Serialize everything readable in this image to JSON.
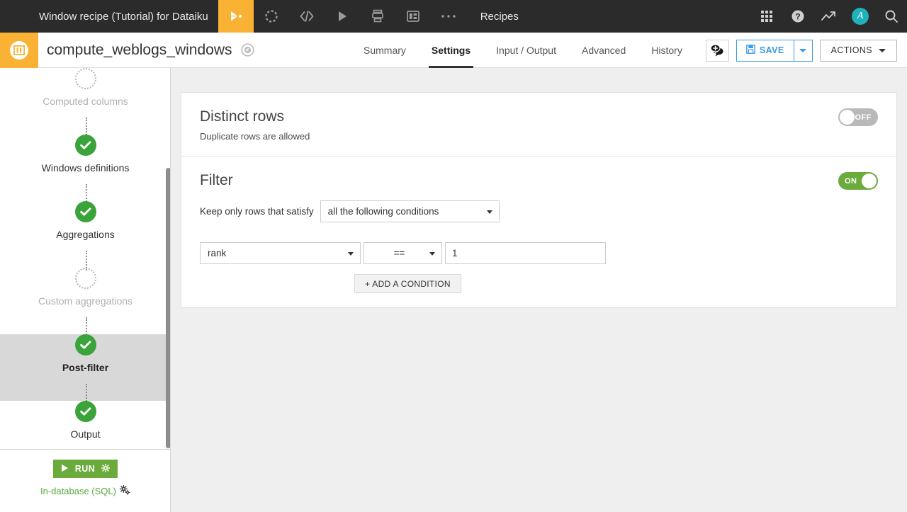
{
  "topbar": {
    "project_title": "Window recipe (Tutorial) for Dataiku",
    "section_label": "Recipes",
    "nav_icons": [
      {
        "name": "flow-icon",
        "active": true
      },
      {
        "name": "datasets-icon",
        "active": false
      },
      {
        "name": "code-icon",
        "active": false
      },
      {
        "name": "jobs-run-icon",
        "active": false
      },
      {
        "name": "jobs-icon",
        "active": false
      },
      {
        "name": "dashboards-icon",
        "active": false
      },
      {
        "name": "more-icon",
        "active": false
      }
    ],
    "right_icons": [
      {
        "name": "apps-grid-icon"
      },
      {
        "name": "help-icon"
      },
      {
        "name": "activity-icon"
      },
      {
        "name": "avatar"
      },
      {
        "name": "search-icon"
      }
    ],
    "avatar_initial": "A"
  },
  "header": {
    "recipe_name": "compute_weblogs_windows",
    "tabs": [
      {
        "label": "Summary",
        "active": false
      },
      {
        "label": "Settings",
        "active": true
      },
      {
        "label": "Input / Output",
        "active": false
      },
      {
        "label": "Advanced",
        "active": false
      },
      {
        "label": "History",
        "active": false
      }
    ],
    "save_label": "SAVE",
    "actions_label": "ACTIONS"
  },
  "sidebar": {
    "steps": [
      {
        "label": "Computed columns",
        "state": "todo",
        "active": false
      },
      {
        "label": "Windows definitions",
        "state": "done",
        "active": false
      },
      {
        "label": "Aggregations",
        "state": "done",
        "active": false
      },
      {
        "label": "Custom aggregations",
        "state": "todo",
        "active": false
      },
      {
        "label": "Post-filter",
        "state": "done",
        "active": true
      },
      {
        "label": "Output",
        "state": "done",
        "active": false
      }
    ],
    "run_label": "RUN",
    "engine_label": "In-database (SQL)"
  },
  "main": {
    "distinct": {
      "title": "Distinct rows",
      "subtitle": "Duplicate rows are allowed",
      "toggle_state": "OFF"
    },
    "filter": {
      "title": "Filter",
      "keep_label": "Keep only rows that satisfy",
      "combine_value": "all the following conditions",
      "toggle_state": "ON",
      "conditions": [
        {
          "column": "rank",
          "operator": "==",
          "value": "1"
        }
      ],
      "add_condition_label": "+ ADD A CONDITION"
    }
  },
  "colors": {
    "brand_orange": "#f9b233",
    "accent_green": "#6aab3c",
    "link_blue": "#3b9ae1",
    "topbar_bg": "#2b2b2b",
    "content_bg": "#efefef"
  }
}
